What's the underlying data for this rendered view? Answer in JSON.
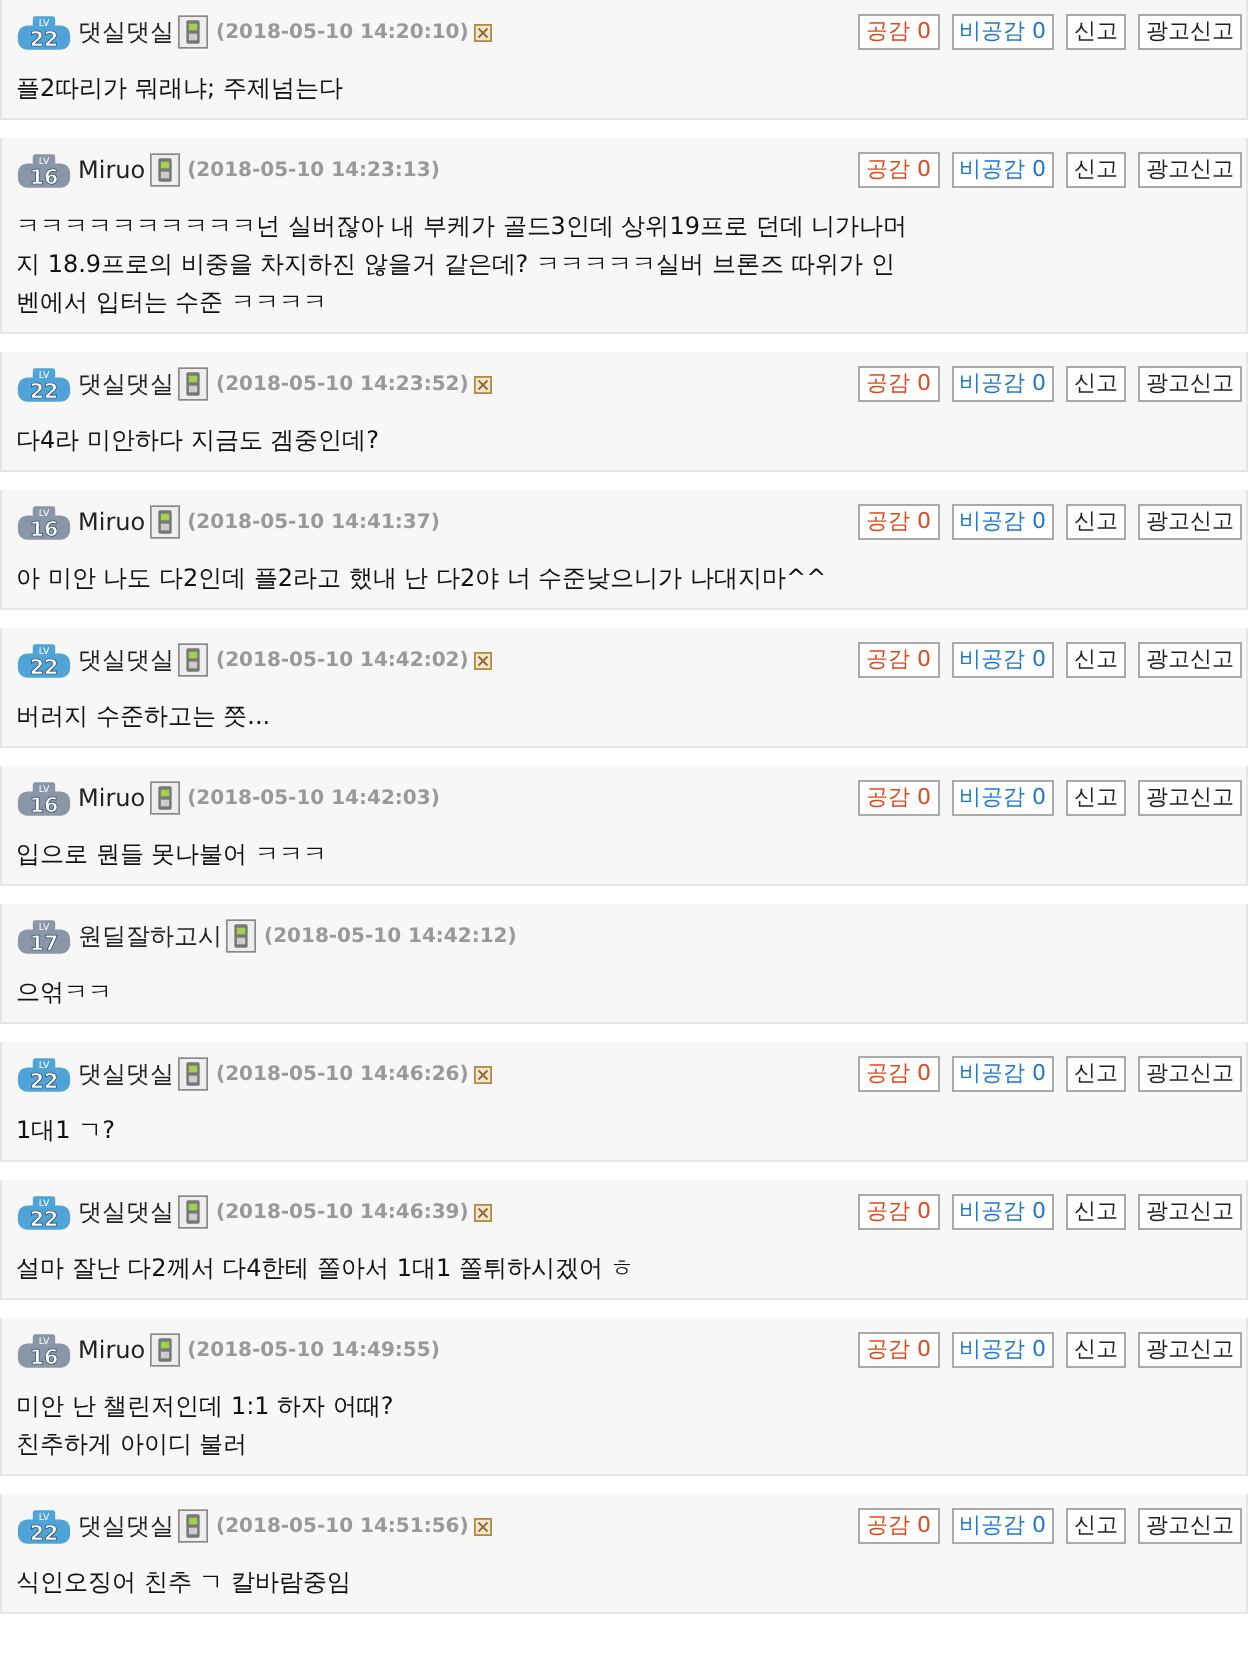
{
  "comments": [
    {
      "level": {
        "label": "LV",
        "number": "22",
        "color": "#4fa3d6"
      },
      "author": "댓실댓실",
      "date": "(2018-05-10 14:20:10)",
      "deletable": true,
      "buttons": [
        {
          "kind": "like",
          "label": "공감 0"
        },
        {
          "kind": "dislike",
          "label": "비공감 0"
        },
        {
          "kind": "plain",
          "label": "신고"
        },
        {
          "kind": "plain",
          "label": "광고신고"
        }
      ],
      "lines": [
        "플2따리가 뭐래냐; 주제넘는다"
      ]
    },
    {
      "level": {
        "label": "LV",
        "number": "16",
        "color": "#8a96a8"
      },
      "author": "Miruo",
      "date": "(2018-05-10 14:23:13)",
      "deletable": false,
      "buttons": [
        {
          "kind": "like",
          "label": "공감 0"
        },
        {
          "kind": "dislike",
          "label": "비공감 0"
        },
        {
          "kind": "plain",
          "label": "신고"
        },
        {
          "kind": "plain",
          "label": "광고신고"
        }
      ],
      "lines": [
        "ㅋㅋㅋㅋㅋㅋㅋㅋㅋㅋ넌 실버잖아 내 부케가 골드3인데 상위19프로 던데 니가나머",
        "지 18.9프로의 비중을 차지하진 않을거 같은데? ㅋㅋㅋㅋㅋ실버 브론즈 따위가 인",
        "벤에서 입터는 수준 ㅋㅋㅋㅋ"
      ]
    },
    {
      "level": {
        "label": "LV",
        "number": "22",
        "color": "#4fa3d6"
      },
      "author": "댓실댓실",
      "date": "(2018-05-10 14:23:52)",
      "deletable": true,
      "buttons": [
        {
          "kind": "like",
          "label": "공감 0"
        },
        {
          "kind": "dislike",
          "label": "비공감 0"
        },
        {
          "kind": "plain",
          "label": "신고"
        },
        {
          "kind": "plain",
          "label": "광고신고"
        }
      ],
      "lines": [
        "다4라 미안하다 지금도 겜중인데?"
      ]
    },
    {
      "level": {
        "label": "LV",
        "number": "16",
        "color": "#8a96a8"
      },
      "author": "Miruo",
      "date": "(2018-05-10 14:41:37)",
      "deletable": false,
      "buttons": [
        {
          "kind": "like",
          "label": "공감 0"
        },
        {
          "kind": "dislike",
          "label": "비공감 0"
        },
        {
          "kind": "plain",
          "label": "신고"
        },
        {
          "kind": "plain",
          "label": "광고신고"
        }
      ],
      "lines": [
        "아 미안 나도 다2인데 플2라고 했내 난 다2야 너 수준낮으니가 나대지마^^"
      ]
    },
    {
      "level": {
        "label": "LV",
        "number": "22",
        "color": "#4fa3d6"
      },
      "author": "댓실댓실",
      "date": "(2018-05-10 14:42:02)",
      "deletable": true,
      "buttons": [
        {
          "kind": "like",
          "label": "공감 0"
        },
        {
          "kind": "dislike",
          "label": "비공감 0"
        },
        {
          "kind": "plain",
          "label": "신고"
        },
        {
          "kind": "plain",
          "label": "광고신고"
        }
      ],
      "lines": [
        "버러지 수준하고는 쯧..."
      ]
    },
    {
      "level": {
        "label": "LV",
        "number": "16",
        "color": "#8a96a8"
      },
      "author": "Miruo",
      "date": "(2018-05-10 14:42:03)",
      "deletable": false,
      "buttons": [
        {
          "kind": "like",
          "label": "공감 0"
        },
        {
          "kind": "dislike",
          "label": "비공감 0"
        },
        {
          "kind": "plain",
          "label": "신고"
        },
        {
          "kind": "plain",
          "label": "광고신고"
        }
      ],
      "lines": [
        "입으로 뭔들 못나불어 ㅋㅋㅋ"
      ]
    },
    {
      "level": {
        "label": "LV",
        "number": "17",
        "color": "#8a96a8"
      },
      "author": "원딜잘하고시",
      "date": "(2018-05-10 14:42:12)",
      "deletable": false,
      "lines": [
        "으얶ㅋㅋ"
      ]
    },
    {
      "level": {
        "label": "LV",
        "number": "22",
        "color": "#4fa3d6"
      },
      "author": "댓실댓실",
      "date": "(2018-05-10 14:46:26)",
      "deletable": true,
      "buttons": [
        {
          "kind": "like",
          "label": "공감 0"
        },
        {
          "kind": "dislike",
          "label": "비공감 0"
        },
        {
          "kind": "plain",
          "label": "신고"
        },
        {
          "kind": "plain",
          "label": "광고신고"
        }
      ],
      "lines": [
        "1대1 ㄱ?"
      ]
    },
    {
      "level": {
        "label": "LV",
        "number": "22",
        "color": "#4fa3d6"
      },
      "author": "댓실댓실",
      "date": "(2018-05-10 14:46:39)",
      "deletable": true,
      "buttons": [
        {
          "kind": "like",
          "label": "공감 0"
        },
        {
          "kind": "dislike",
          "label": "비공감 0"
        },
        {
          "kind": "plain",
          "label": "신고"
        },
        {
          "kind": "plain",
          "label": "광고신고"
        }
      ],
      "lines": [
        "설마 잘난 다2께서 다4한테 쫄아서 1대1 쫄튀하시겠어 ㅎ"
      ]
    },
    {
      "level": {
        "label": "LV",
        "number": "16",
        "color": "#8a96a8"
      },
      "author": "Miruo",
      "date": "(2018-05-10 14:49:55)",
      "deletable": false,
      "buttons": [
        {
          "kind": "like",
          "label": "공감 0"
        },
        {
          "kind": "dislike",
          "label": "비공감 0"
        },
        {
          "kind": "plain",
          "label": "신고"
        },
        {
          "kind": "plain",
          "label": "광고신고"
        }
      ],
      "lines": [
        "미안 난 챌린저인데 1:1 하자 어때?",
        "친추하게 아이디 불러"
      ]
    },
    {
      "level": {
        "label": "LV",
        "number": "22",
        "color": "#4fa3d6"
      },
      "author": "댓실댓실",
      "date": "(2018-05-10 14:51:56)",
      "deletable": true,
      "buttons": [
        {
          "kind": "like",
          "label": "공감 0"
        },
        {
          "kind": "dislike",
          "label": "비공감 0"
        },
        {
          "kind": "plain",
          "label": "신고"
        },
        {
          "kind": "plain",
          "label": "광고신고"
        }
      ],
      "lines": [
        "식인오징어 친추 ㄱ 칼바람중임"
      ]
    }
  ]
}
